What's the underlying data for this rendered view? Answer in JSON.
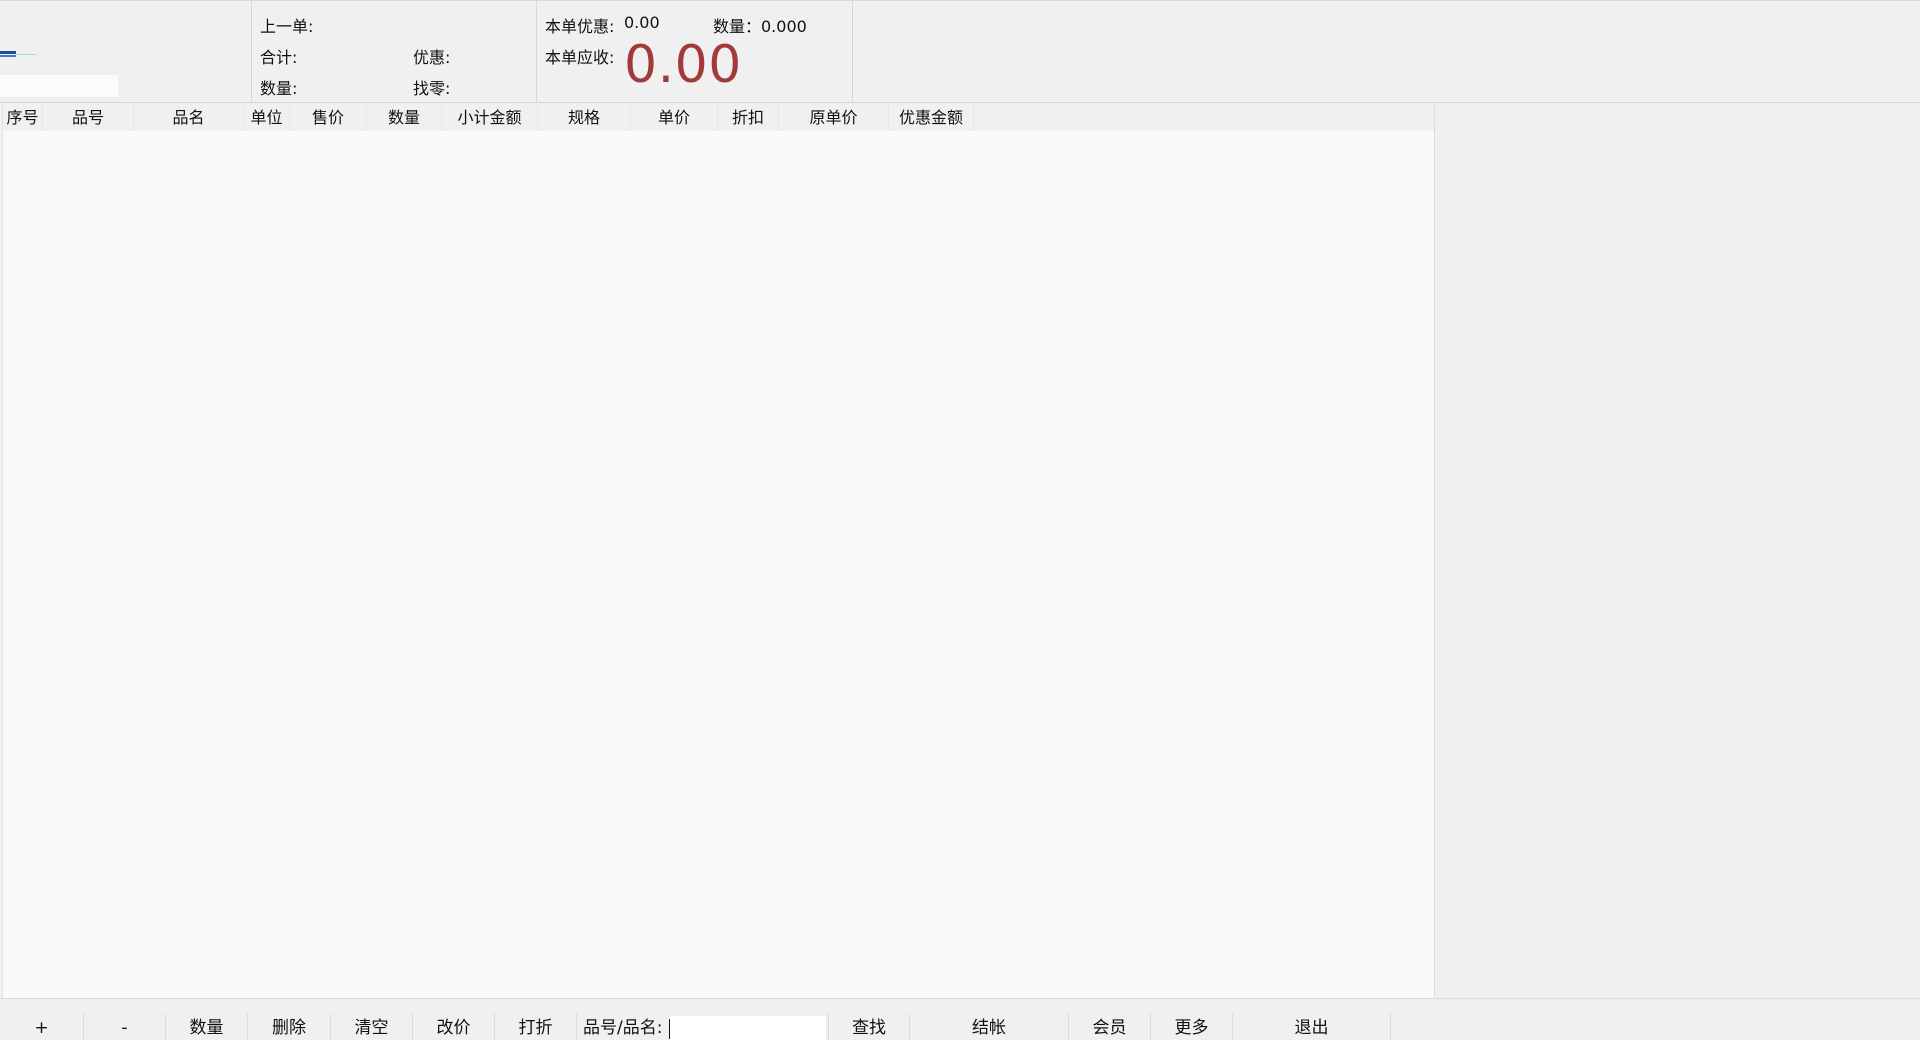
{
  "header": {
    "logo": {
      "mark": "logo-bars-icon",
      "field_value": ""
    },
    "last_order": {
      "last_label": "上一单:",
      "total_label": "合计:",
      "qty_label": "数量:",
      "discount_label": "优惠:",
      "change_label": "找零:"
    },
    "current": {
      "discount_label": "本单优惠:",
      "discount_value": "0.00",
      "qty_text": "数量：0.000",
      "receivable_label": "本单应收:",
      "receivable_value": "0.00",
      "receivable_color": "#a33a3a"
    }
  },
  "grid": {
    "columns": [
      "序号",
      "品号",
      "品名",
      "单位",
      "售价",
      "数量",
      "小计金额",
      "规格",
      "单价",
      "折扣",
      "原单价",
      "优惠金额"
    ],
    "rows": []
  },
  "toolbar": {
    "plus": "+",
    "minus": "-",
    "qty": "数量",
    "delete": "删除",
    "clear": "清空",
    "change_price": "改价",
    "discount": "打折",
    "search_label": "品号/品名:",
    "search_value": "",
    "find": "查找",
    "checkout": "结帐",
    "member": "会员",
    "more": "更多",
    "exit": "退出"
  }
}
